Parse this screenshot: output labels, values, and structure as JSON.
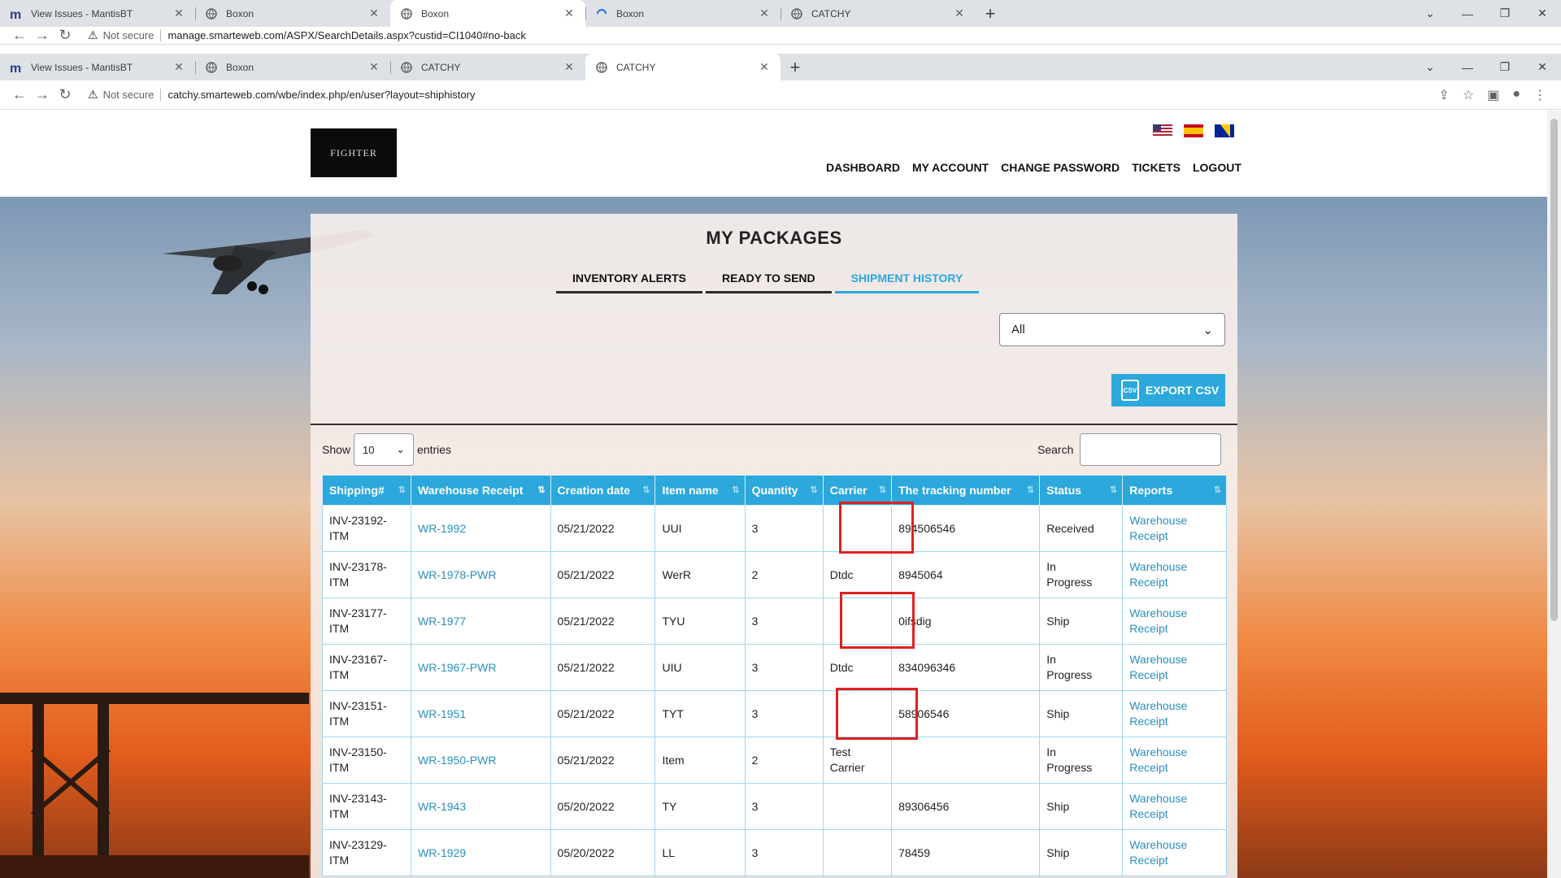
{
  "browser_back": {
    "tabs": [
      {
        "title": "View Issues - MantisBT",
        "icon": "mantis-icon",
        "active": false
      },
      {
        "title": "Boxon",
        "icon": "globe-icon",
        "active": false
      },
      {
        "title": "Boxon",
        "icon": "globe-icon",
        "active": true
      },
      {
        "title": "Boxon",
        "icon": "loading-icon",
        "active": false
      },
      {
        "title": "CATCHY",
        "icon": "globe-icon",
        "active": false
      }
    ],
    "url_security": "Not secure",
    "url": "manage.smarteweb.com/ASPX/SearchDetails.aspx?custid=CI1040#no-back"
  },
  "browser": {
    "tabs": [
      {
        "title": "View Issues - MantisBT",
        "icon": "mantis-icon",
        "active": false
      },
      {
        "title": "Boxon",
        "icon": "globe-icon",
        "active": false
      },
      {
        "title": "CATCHY",
        "icon": "globe-icon",
        "active": false
      },
      {
        "title": "CATCHY",
        "icon": "globe-icon",
        "active": true
      }
    ],
    "url_security": "Not secure",
    "url": "catchy.smarteweb.com/wbe/index.php/en/user?layout=shiphistory"
  },
  "site": {
    "logo_text": "FIGHTER",
    "flags": [
      "flag-us-icon",
      "flag-es-icon",
      "flag-ba-icon"
    ],
    "menu": [
      "DASHBOARD",
      "MY ACCOUNT",
      "CHANGE PASSWORD",
      "TICKETS",
      "LOGOUT"
    ]
  },
  "packages": {
    "title": "MY PACKAGES",
    "tabs": [
      "INVENTORY ALERTS",
      "READY TO SEND",
      "SHIPMENT HISTORY"
    ],
    "active_tab": "SHIPMENT HISTORY",
    "filter_value": "All",
    "export_label": "EXPORT CSV",
    "export_icon_text": "CSV",
    "show_label": "Show",
    "entries_value": "10",
    "entries_label": "entries",
    "search_label": "Search",
    "columns": [
      "Shipping#",
      "Warehouse Receipt",
      "Creation date",
      "Item name",
      "Quantity",
      "Carrier",
      "The tracking number",
      "Status",
      "Reports"
    ],
    "rows": [
      {
        "ship1": "INV-23192-",
        "ship2": "ITM",
        "wr": "WR-1992",
        "date": "05/21/2022",
        "item": "UUI",
        "qty": "3",
        "carrier1": "",
        "carrier2": "",
        "track": "894506546",
        "status1": "Received",
        "status2": "",
        "rep1": "Warehouse",
        "rep2": "Receipt"
      },
      {
        "ship1": "INV-23178-",
        "ship2": "ITM",
        "wr": "WR-1978-PWR",
        "date": "05/21/2022",
        "item": "WerR",
        "qty": "2",
        "carrier1": "Dtdc",
        "carrier2": "",
        "track": "8945064",
        "status1": "In",
        "status2": "Progress",
        "rep1": "Warehouse",
        "rep2": "Receipt"
      },
      {
        "ship1": "INV-23177-ITM",
        "ship2": "",
        "wr": "WR-1977",
        "date": "05/21/2022",
        "item": "TYU",
        "qty": "3",
        "carrier1": "",
        "carrier2": "",
        "track": "0ifsdig",
        "status1": "Ship",
        "status2": "",
        "rep1": "Warehouse",
        "rep2": "Receipt"
      },
      {
        "ship1": "INV-23167-",
        "ship2": "ITM",
        "wr": "WR-1967-PWR",
        "date": "05/21/2022",
        "item": "UIU",
        "qty": "3",
        "carrier1": "Dtdc",
        "carrier2": "",
        "track": "834096346",
        "status1": "In",
        "status2": "Progress",
        "rep1": "Warehouse",
        "rep2": "Receipt"
      },
      {
        "ship1": "INV-23151-ITM",
        "ship2": "",
        "wr": "WR-1951",
        "date": "05/21/2022",
        "item": "TYT",
        "qty": "3",
        "carrier1": "",
        "carrier2": "",
        "track": "58906546",
        "status1": "Ship",
        "status2": "",
        "rep1": "Warehouse",
        "rep2": "Receipt"
      },
      {
        "ship1": "INV-23150-",
        "ship2": "ITM",
        "wr": "WR-1950-PWR",
        "date": "05/21/2022",
        "item": "Item",
        "qty": "2",
        "carrier1": "Test",
        "carrier2": "Carrier",
        "track": "",
        "status1": "In",
        "status2": "Progress",
        "rep1": "Warehouse",
        "rep2": "Receipt"
      },
      {
        "ship1": "INV-23143-ITM",
        "ship2": "",
        "wr": "WR-1943",
        "date": "05/20/2022",
        "item": "TY",
        "qty": "3",
        "carrier1": "",
        "carrier2": "",
        "track": "89306456",
        "status1": "Ship",
        "status2": "",
        "rep1": "Warehouse",
        "rep2": "Receipt"
      },
      {
        "ship1": "INV-23129-",
        "ship2": "ITM",
        "wr": "WR-1929",
        "date": "05/20/2022",
        "item": "LL",
        "qty": "3",
        "carrier1": "",
        "carrier2": "",
        "track": "78459",
        "status1": "Ship",
        "status2": "",
        "rep1": "Warehouse",
        "rep2": "Receipt"
      }
    ]
  },
  "colors": {
    "accent": "#2ca8dd",
    "link": "#2a8fbd",
    "highlight": "#e02020"
  }
}
